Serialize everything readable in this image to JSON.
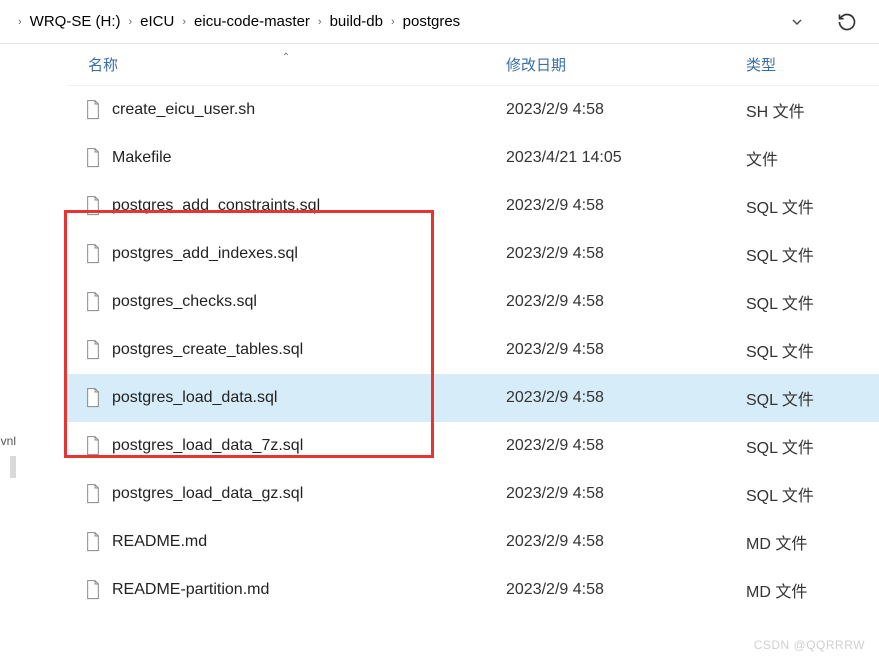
{
  "breadcrumb": {
    "items": [
      {
        "label": "WRQ-SE (H:)"
      },
      {
        "label": "eICU"
      },
      {
        "label": "eicu-code-master"
      },
      {
        "label": "build-db"
      },
      {
        "label": "postgres"
      }
    ],
    "sep": "›"
  },
  "columns": {
    "name": "名称",
    "date": "修改日期",
    "type": "类型"
  },
  "files": [
    {
      "name": "create_eicu_user.sh",
      "date": "2023/2/9 4:58",
      "type": "SH 文件",
      "selected": false
    },
    {
      "name": "Makefile",
      "date": "2023/4/21 14:05",
      "type": "文件",
      "selected": false
    },
    {
      "name": "postgres_add_constraints.sql",
      "date": "2023/2/9 4:58",
      "type": "SQL 文件",
      "selected": false
    },
    {
      "name": "postgres_add_indexes.sql",
      "date": "2023/2/9 4:58",
      "type": "SQL 文件",
      "selected": false
    },
    {
      "name": "postgres_checks.sql",
      "date": "2023/2/9 4:58",
      "type": "SQL 文件",
      "selected": false
    },
    {
      "name": "postgres_create_tables.sql",
      "date": "2023/2/9 4:58",
      "type": "SQL 文件",
      "selected": false
    },
    {
      "name": "postgres_load_data.sql",
      "date": "2023/2/9 4:58",
      "type": "SQL 文件",
      "selected": true
    },
    {
      "name": "postgres_load_data_7z.sql",
      "date": "2023/2/9 4:58",
      "type": "SQL 文件",
      "selected": false
    },
    {
      "name": "postgres_load_data_gz.sql",
      "date": "2023/2/9 4:58",
      "type": "SQL 文件",
      "selected": false
    },
    {
      "name": "README.md",
      "date": "2023/2/9 4:58",
      "type": "MD 文件",
      "selected": false
    },
    {
      "name": "README-partition.md",
      "date": "2023/2/9 4:58",
      "type": "MD 文件",
      "selected": false
    }
  ],
  "sidebar": {
    "tab": "vnl"
  },
  "watermark": "CSDN @QQRRRW"
}
